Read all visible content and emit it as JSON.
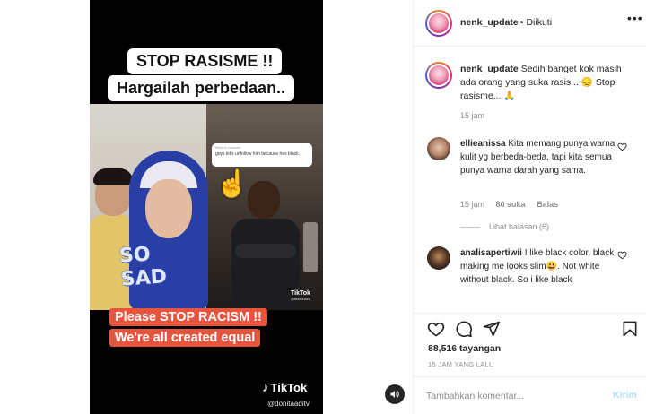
{
  "video": {
    "title_line1": "STOP RASISME !!",
    "title_line2": "Hargailah perbedaan..",
    "sticker_text_1": "SO",
    "sticker_text_2": "SAD",
    "bubble_hint": "Reply to comment",
    "bubble_text": "guys let's unfollow him because hes black.",
    "inner_tiktok": "TikTok",
    "inner_tiktok_user": "@tiktokuser",
    "banner_line1": "Please STOP RACISM !!",
    "banner_line2": "We're all created equal",
    "tiktok_brand": "TikTok",
    "tiktok_user": "@donitaaditv",
    "accent": "#e8553f"
  },
  "header": {
    "username": "nenk_update",
    "separator": "•",
    "follow_status": "Diikuti",
    "more_icon": "more-horizontal-icon"
  },
  "caption": {
    "username": "nenk_update",
    "text": "Sedih banget kok masih ada orang yang suka rasis... 😞 Stop rasisme... 🙏",
    "time": "15 jam"
  },
  "comments": [
    {
      "username": "ellieanissa",
      "text": "Kita memang punya warna kulit yg berbeda-beda, tapi kita semua punya warna darah yang sama.",
      "time": "15 jam",
      "likes": "80 suka",
      "reply_label": "Balas",
      "view_replies": "Lihat balasan (6)"
    },
    {
      "username": "analisapertiwii",
      "text": "I like black color, black making me looks slim😃. Not white without black. So i like black"
    }
  ],
  "actions": {
    "views": "88,516 tayangan",
    "posted": "15 JAM YANG LALU"
  },
  "add_comment": {
    "placeholder": "Tambahkan komentar...",
    "send_label": "Kirim"
  }
}
